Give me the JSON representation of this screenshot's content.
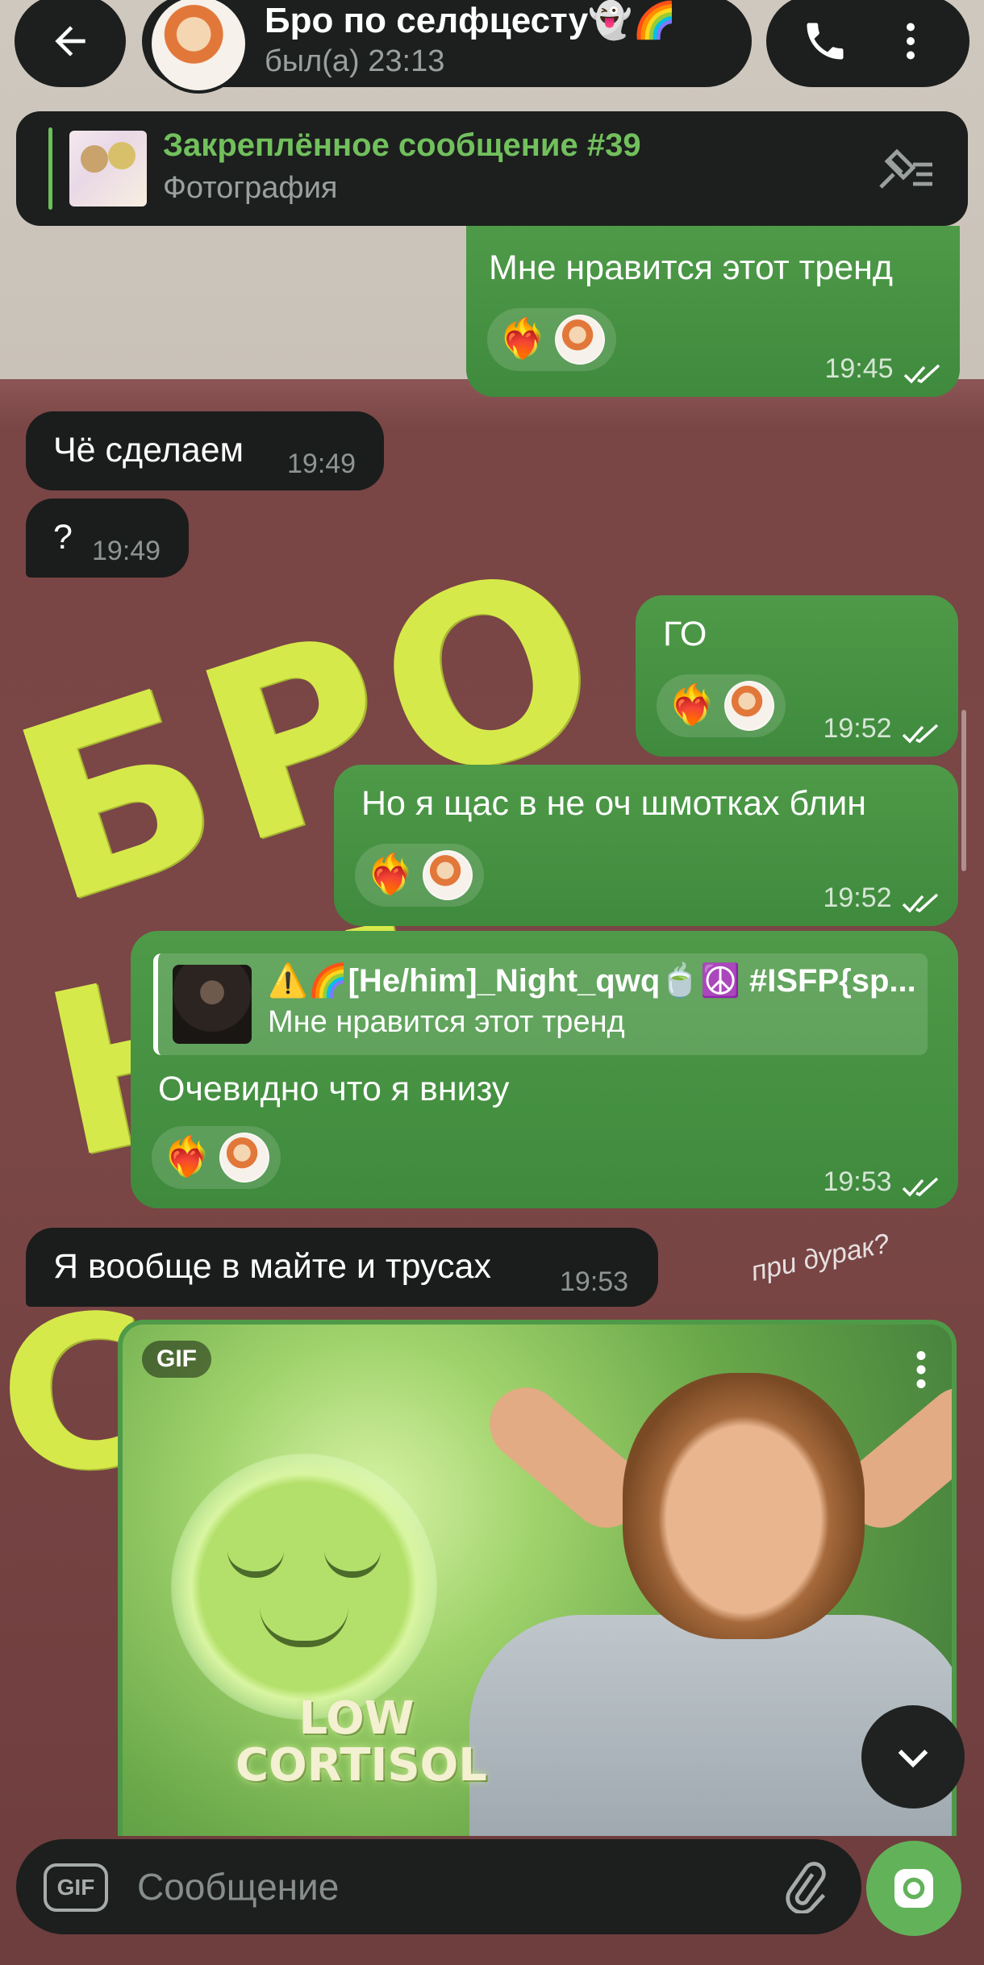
{
  "header": {
    "contact_name": "Бро по селфцесту👻🌈",
    "status": "был(а) 23:13",
    "icons": [
      "back-arrow-icon",
      "phone-icon",
      "more-vertical-icon"
    ]
  },
  "pinned": {
    "title": "Закреплённое сообщение #39",
    "subtitle": "Фотография",
    "icon": "unpin-list-icon"
  },
  "messages": [
    {
      "direction": "out",
      "text": "Мне нравится этот тренд",
      "time": "19:45",
      "reactions": [
        "❤️‍🔥",
        "avatar"
      ],
      "read": true
    },
    {
      "direction": "in",
      "text": "Чё сделаем",
      "time": "19:49"
    },
    {
      "direction": "in",
      "text": "?",
      "time": "19:49"
    },
    {
      "direction": "out",
      "text": "ГО",
      "time": "19:52",
      "reactions": [
        "❤️‍🔥",
        "avatar"
      ],
      "read": true
    },
    {
      "direction": "out",
      "text": "Но я щас в не оч шмотках блин",
      "time": "19:52",
      "reactions": [
        "❤️‍🔥",
        "avatar"
      ],
      "read": true
    },
    {
      "direction": "out",
      "reply_name": "⚠️🌈[He/him]_Night_qwq🍵☮️ #ISFP{sp...",
      "reply_text": "Мне нравится этот тренд",
      "text": "Очевидно что я внизу",
      "time": "19:53",
      "reactions": [
        "❤️‍🔥",
        "avatar"
      ],
      "read": true
    },
    {
      "direction": "in",
      "text": "Я вообще в майте и трусах",
      "time": "19:53"
    }
  ],
  "gif": {
    "badge": "GIF",
    "caption_line1": "LOW",
    "caption_line2": "CORTISOL"
  },
  "wallpaper": {
    "scribble1": "БРО",
    "scribble2": "НИ",
    "scribble3": "С",
    "small_note": "при дурак?"
  },
  "composer": {
    "gif_label": "GIF",
    "placeholder": "Сообщение"
  },
  "colors": {
    "outgoing_bubble": "#4e9a48",
    "incoming_bubble": "#1b1d1c",
    "accent": "#62b25a",
    "pinned_title": "#72c05d"
  }
}
